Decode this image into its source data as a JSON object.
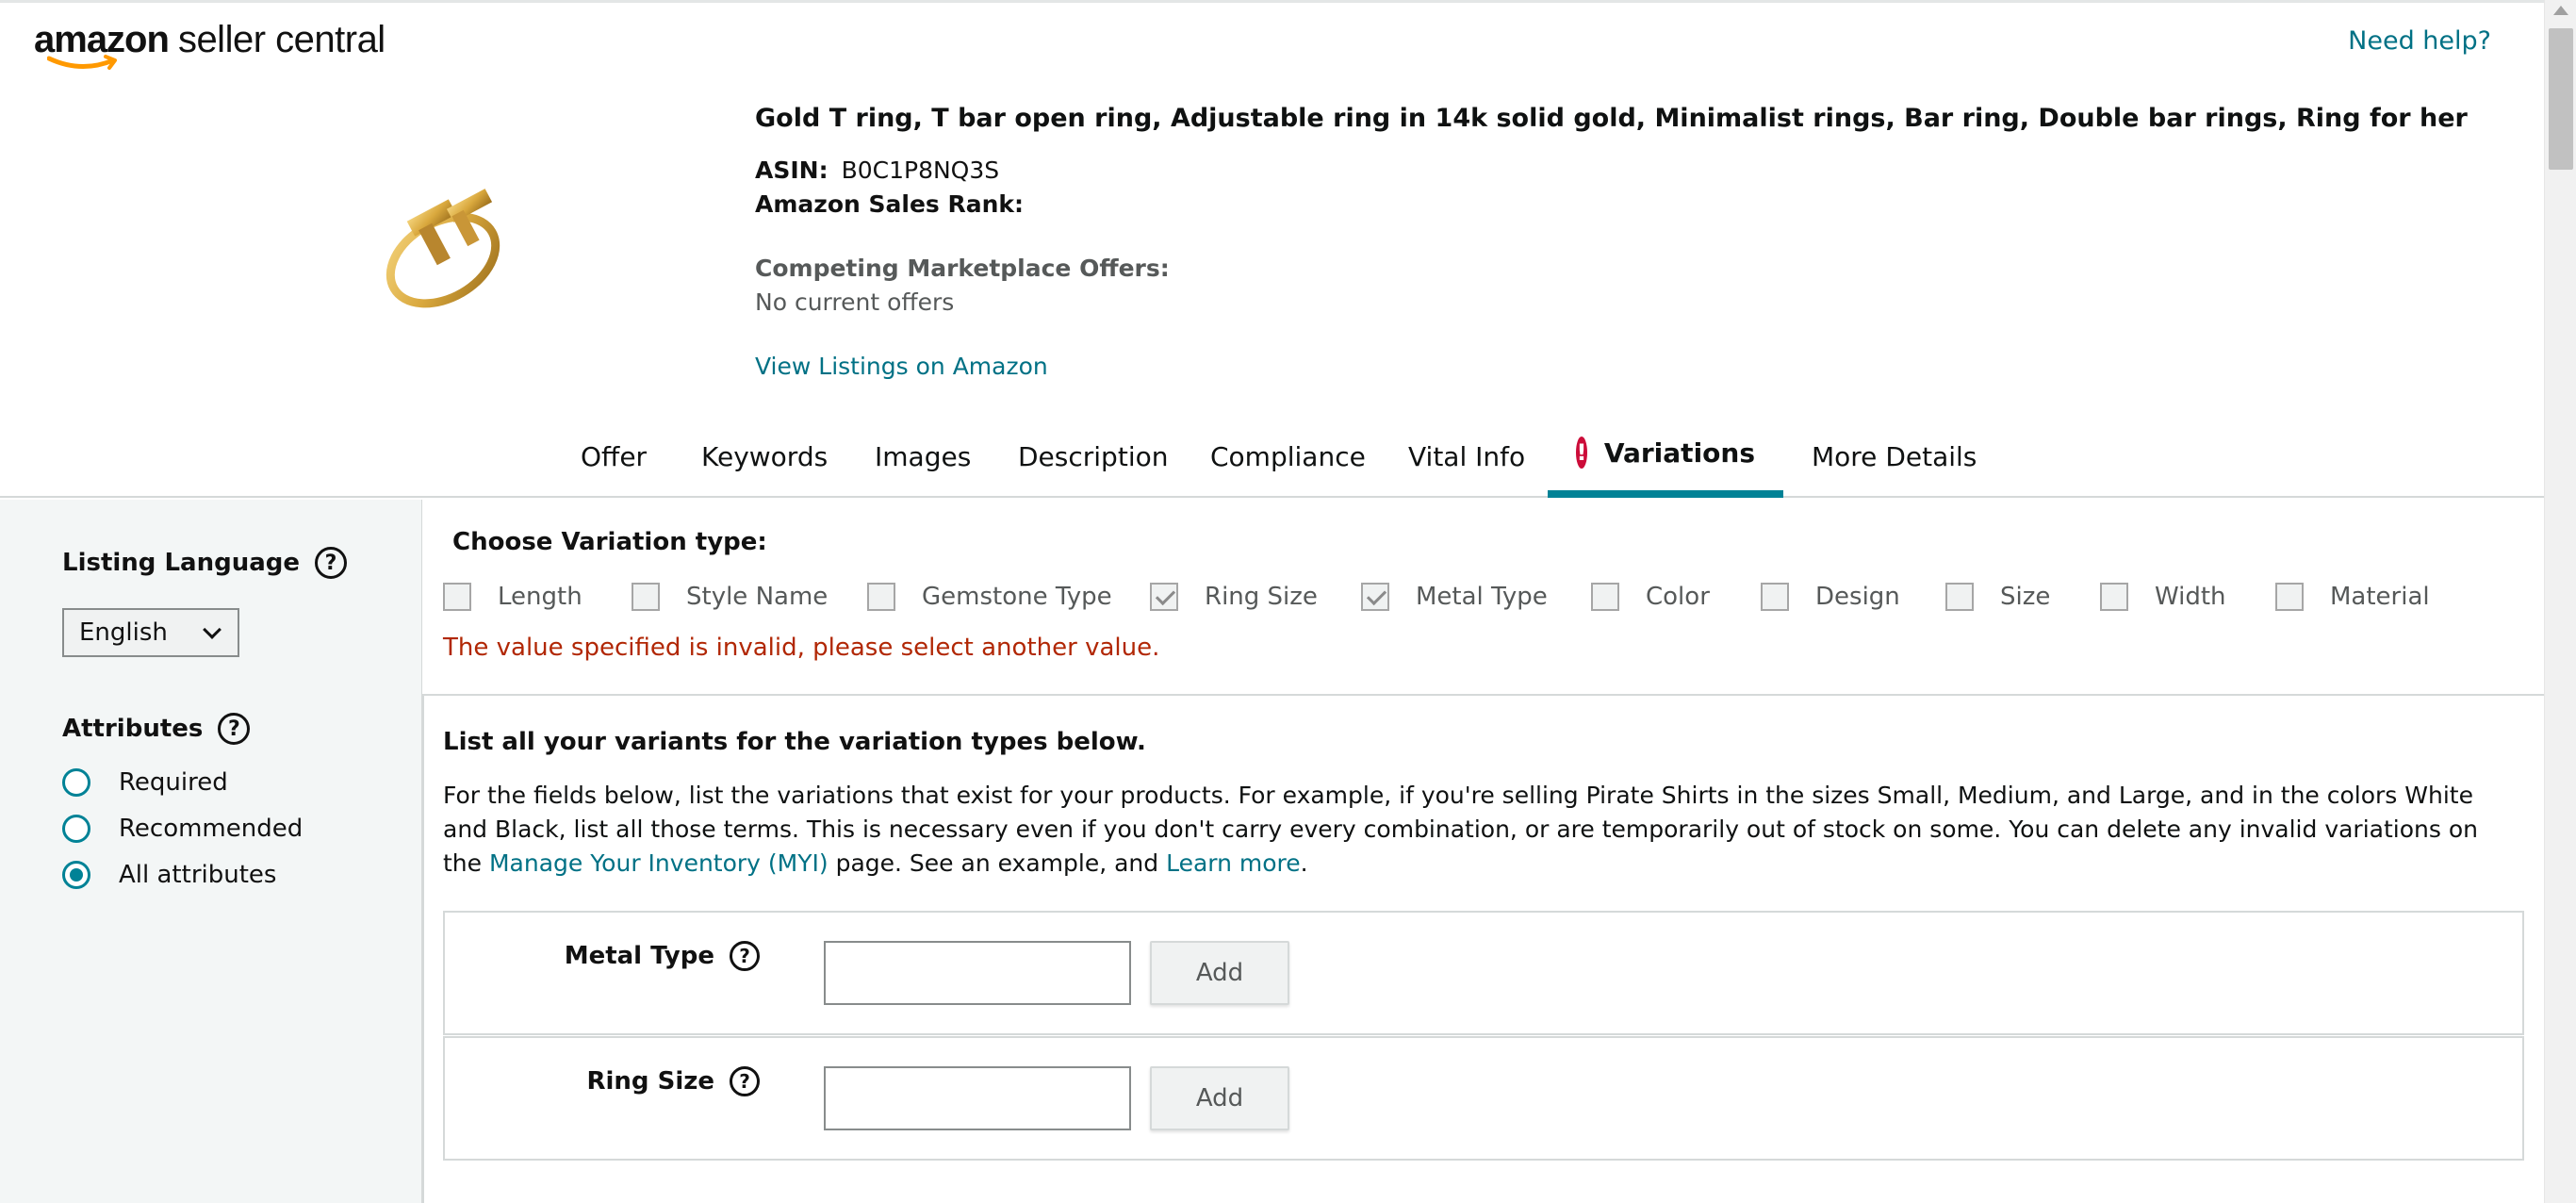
{
  "header": {
    "logo_brand": "amazon",
    "logo_product": "seller central",
    "help_link": "Need help?"
  },
  "product": {
    "title": "Gold T ring, T bar open ring, Adjustable ring in 14k solid gold, Minimalist rings, Bar ring, Double bar rings, Ring for her",
    "asin_label": "ASIN:",
    "asin_value": "B0C1P8NQ3S",
    "sales_rank_label": "Amazon Sales Rank:",
    "competing_label": "Competing Marketplace Offers:",
    "competing_value": "No current offers",
    "view_listings_link": "View Listings on Amazon"
  },
  "tabs": [
    {
      "label": "Offer"
    },
    {
      "label": "Keywords"
    },
    {
      "label": "Images"
    },
    {
      "label": "Description"
    },
    {
      "label": "Compliance"
    },
    {
      "label": "Vital Info"
    },
    {
      "label": "Variations"
    },
    {
      "label": "More Details"
    }
  ],
  "active_tab": "Variations",
  "sidebar": {
    "listing_language_label": "Listing Language",
    "language_value": "English",
    "attributes_label": "Attributes",
    "attribute_options": [
      {
        "label": "Required"
      },
      {
        "label": "Recommended"
      },
      {
        "label": "All attributes"
      }
    ],
    "selected_attribute": "All attributes"
  },
  "variation_types": {
    "heading": "Choose Variation type:",
    "items": [
      {
        "label": "Length",
        "checked": false
      },
      {
        "label": "Style Name",
        "checked": false
      },
      {
        "label": "Gemstone Type",
        "checked": false
      },
      {
        "label": "Ring Size",
        "checked": true
      },
      {
        "label": "Metal Type",
        "checked": true
      },
      {
        "label": "Color",
        "checked": false
      },
      {
        "label": "Design",
        "checked": false
      },
      {
        "label": "Size",
        "checked": false
      },
      {
        "label": "Width",
        "checked": false
      },
      {
        "label": "Material",
        "checked": false
      }
    ],
    "error_message": "The value specified is invalid, please select another value."
  },
  "variants": {
    "heading": "List all your variants for the variation types below.",
    "description_part1": "For the fields below, list the variations that exist for your products. For example, if you're selling Pirate Shirts in the sizes Small, Medium, and Large, and in the colors White and Black, list all those terms. This is necessary even if you don't carry every combination, or are temporarily out of stock on some. You can delete any invalid variations on the ",
    "myi_link": "Manage Your Inventory (MYI)",
    "description_part2": " page. See an example, and ",
    "learn_more_link": "Learn more",
    "description_part3": ".",
    "rows": [
      {
        "label": "Metal Type",
        "value": "",
        "button": "Add"
      },
      {
        "label": "Ring Size",
        "value": "",
        "button": "Add"
      }
    ]
  },
  "colors": {
    "link": "#007185",
    "accent_teal": "#008296",
    "error_red": "#b12704",
    "error_icon": "#cc0c39"
  }
}
